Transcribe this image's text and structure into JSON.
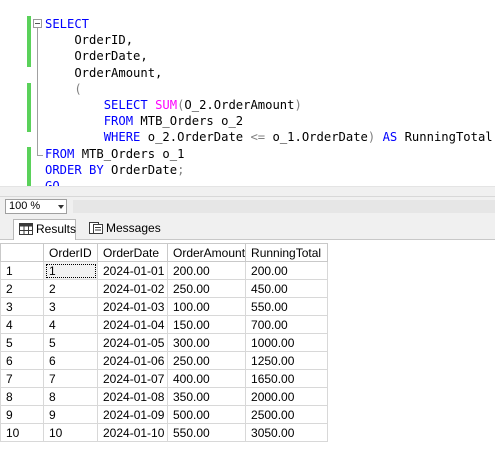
{
  "editor": {
    "lines": [
      [
        {
          "t": "SELECT",
          "c": "kw"
        }
      ],
      [
        {
          "t": "    OrderID,",
          "c": ""
        }
      ],
      [
        {
          "t": "    OrderDate,",
          "c": ""
        }
      ],
      [
        {
          "t": "    OrderAmount,",
          "c": ""
        }
      ],
      [
        {
          "t": "    (",
          "c": "op"
        }
      ],
      [
        {
          "t": "        SELECT ",
          "c": "kw"
        },
        {
          "t": "SUM",
          "c": "fn"
        },
        {
          "t": "(",
          "c": "op"
        },
        {
          "t": "O_2.OrderAmount",
          "c": ""
        },
        {
          "t": ")",
          "c": "op"
        }
      ],
      [
        {
          "t": "        FROM ",
          "c": "kw"
        },
        {
          "t": "MTB_Orders o_2",
          "c": ""
        }
      ],
      [
        {
          "t": "        WHERE ",
          "c": "kw"
        },
        {
          "t": "o_2.OrderDate ",
          "c": ""
        },
        {
          "t": "<=",
          "c": "op"
        },
        {
          "t": " o_1.OrderDate",
          "c": ""
        },
        {
          "t": ")",
          "c": "op"
        },
        {
          "t": " AS ",
          "c": "kw"
        },
        {
          "t": "RunningTotal",
          "c": ""
        }
      ],
      [
        {
          "t": "FROM ",
          "c": "kw"
        },
        {
          "t": "MTB_Orders o_1",
          "c": ""
        }
      ],
      [
        {
          "t": "ORDER BY ",
          "c": "kw"
        },
        {
          "t": "OrderDate",
          "c": ""
        },
        {
          "t": ";",
          "c": "op"
        }
      ],
      [
        {
          "t": "GO",
          "c": "kw"
        }
      ]
    ],
    "colors": {
      "keyword": "#0000ff",
      "function": "#ff00ff",
      "operator": "#808080",
      "change_bar": "#5ad15a"
    }
  },
  "zoom": {
    "value": "100 %"
  },
  "tabs": {
    "results": "Results",
    "messages": "Messages"
  },
  "grid": {
    "columns": [
      "OrderID",
      "OrderDate",
      "OrderAmount",
      "RunningTotal"
    ],
    "rows": [
      {
        "n": "1",
        "cells": [
          "1",
          "2024-01-01",
          "200.00",
          "200.00"
        ]
      },
      {
        "n": "2",
        "cells": [
          "2",
          "2024-01-02",
          "250.00",
          "450.00"
        ]
      },
      {
        "n": "3",
        "cells": [
          "3",
          "2024-01-03",
          "100.00",
          "550.00"
        ]
      },
      {
        "n": "4",
        "cells": [
          "4",
          "2024-01-04",
          "150.00",
          "700.00"
        ]
      },
      {
        "n": "5",
        "cells": [
          "5",
          "2024-01-05",
          "300.00",
          "1000.00"
        ]
      },
      {
        "n": "6",
        "cells": [
          "6",
          "2024-01-06",
          "250.00",
          "1250.00"
        ]
      },
      {
        "n": "7",
        "cells": [
          "7",
          "2024-01-07",
          "400.00",
          "1650.00"
        ]
      },
      {
        "n": "8",
        "cells": [
          "8",
          "2024-01-08",
          "350.00",
          "2000.00"
        ]
      },
      {
        "n": "9",
        "cells": [
          "9",
          "2024-01-09",
          "500.00",
          "2500.00"
        ]
      },
      {
        "n": "10",
        "cells": [
          "10",
          "2024-01-10",
          "550.00",
          "3050.00"
        ]
      }
    ]
  }
}
